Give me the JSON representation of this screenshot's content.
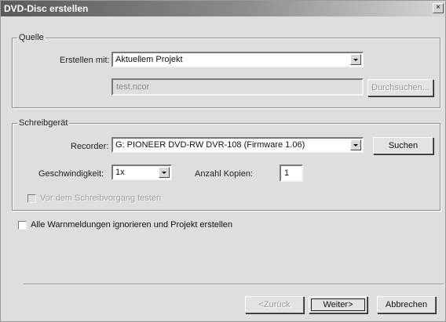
{
  "window": {
    "title": "DVD-Disc erstellen",
    "close_label": "×"
  },
  "source": {
    "legend": "Quelle",
    "create_with_label": "Erstellen mit:",
    "create_with_value": "Aktuellem Projekt",
    "file_value": "test.ncor",
    "browse_label": "Durchsuchen..."
  },
  "writer": {
    "legend": "Schreibgerät",
    "recorder_label": "Recorder:",
    "recorder_value": "G: PIONEER DVD-RW  DVR-108 (Firmware 1.06)",
    "search_label": "Suchen",
    "speed_label": "Geschwindigkeit:",
    "speed_value": "1x",
    "copies_label": "Anzahl Kopien:",
    "copies_value": "1",
    "test_label": "Vor dem Schreibvorgang testen",
    "test_checked": false
  },
  "ignore_warnings": {
    "label": "Alle Warnmeldungen ignorieren und Projekt erstellen",
    "checked": false
  },
  "footer": {
    "back_label": "<Zurück",
    "next_label": "Weiter>",
    "cancel_label": "Abbrechen"
  }
}
